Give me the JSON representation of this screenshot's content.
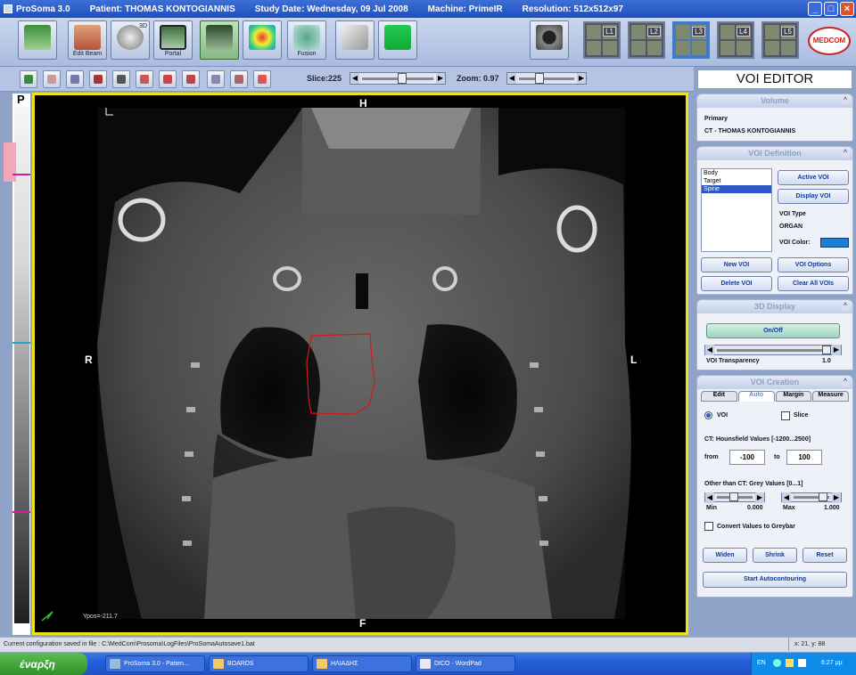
{
  "window": {
    "title": "ProSoma 3.0",
    "patient": "Patient: THOMAS KONTOGIANNIS",
    "study_date": "Study Date: Wednesday, 09 Jul 2008",
    "machine": "Machine: PrimeIR",
    "resolution": "Resolution: 512x512x97"
  },
  "toolbar": {
    "buttons": [
      {
        "icon": "save-icon",
        "label": ""
      },
      {
        "icon": "edit-beam-icon",
        "label": "Edit Beam"
      },
      {
        "icon": "3d-head-icon",
        "label": "3D"
      },
      {
        "icon": "portal-icon",
        "label": "Portal"
      },
      {
        "icon": "body-contour-icon",
        "label": ""
      },
      {
        "icon": "dose-map-icon",
        "label": ""
      },
      {
        "icon": "fusion-icon",
        "label": "Fusion"
      },
      {
        "icon": "scissors-icon",
        "label": ""
      },
      {
        "icon": "monitor-icon",
        "label": ""
      }
    ],
    "camera_icon": "camera-icon",
    "layouts": [
      "L1",
      "L2",
      "L3",
      "L4",
      "L5"
    ],
    "logo": "MEDCOM"
  },
  "toolbar2": {
    "slice_label": "Slice:225",
    "zoom_label": "Zoom: 0.97",
    "tools": [
      "select-icon",
      "pan-icon",
      "ruler-icon",
      "window-level-icon",
      "crop-icon",
      "voi-icon",
      "voi-alt-icon",
      "brush-icon",
      "center-icon",
      "grid-icon",
      "palette-icon"
    ]
  },
  "viewer": {
    "left_mark": "P",
    "top": "H",
    "bottom": "F",
    "left": "R",
    "right": "L",
    "ypos": "Ypos=-211.7"
  },
  "panel": {
    "title": "VOI EDITOR",
    "volume": {
      "head": "Volume",
      "label": "Primary",
      "value": "CT - THOMAS KONTOGIANNIS"
    },
    "voi_def": {
      "head": "VOI Definition",
      "list": [
        "Body",
        "Target",
        "Spine"
      ],
      "active_btn": "Active VOI",
      "display_btn": "Display VOI",
      "type_label": "VOI Type",
      "type_value": "ORGAN",
      "color_label": "VOI Color:",
      "color": "#1c7fd6",
      "new_btn": "New VOI",
      "options_btn": "VOI Options",
      "delete_btn": "Delete VOI",
      "clear_btn": "Clear All VOIs"
    },
    "display3d": {
      "head": "3D Display",
      "toggle": "On/Off",
      "transparency_label": "VOI Transparency",
      "transparency_value": "1.0"
    },
    "creation": {
      "head": "VOI Creation",
      "tabs": [
        "Edit",
        "Auto",
        "Margin",
        "Measure"
      ],
      "voi_radio": "VOI",
      "slice_check": "Slice",
      "hu_label": "CT: Hounsfield Values [-1200...2500]",
      "from_label": "from",
      "from_value": "-100",
      "to_label": "to",
      "to_value": "100",
      "grey_label": "Other than CT: Grey Values [0...1]",
      "min_label": "Min",
      "min_value": "0.000",
      "max_label": "Max",
      "max_value": "1.000",
      "convert_label": "Convert Values to Greybar",
      "widen": "Widen",
      "shrink": "Shrink",
      "reset": "Reset",
      "start": "Start Autocontouring"
    }
  },
  "status": {
    "left": "Current configuration saved in file : C:\\MedCom\\Prosoma\\LogFiles\\ProSomaAutosave1.bat",
    "right": "x: 21, y: 88"
  },
  "taskbar": {
    "start": "έναρξη",
    "tasks": [
      "ProSoma 3.0 - Patien...",
      "BOARDS",
      "ΗΛΙΑΔΗΣ",
      "DICO - WordPad"
    ],
    "lang": "EN",
    "time": "6:27 μμ"
  }
}
